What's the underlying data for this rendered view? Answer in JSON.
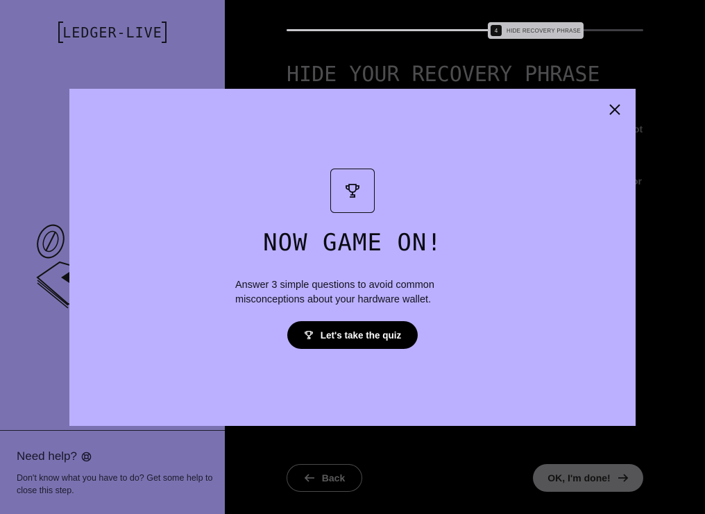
{
  "logo": {
    "text": "LEDGER-LIVE"
  },
  "help": {
    "title": "Need help?",
    "text": "Don't know what you have to do? Get some help to close this step."
  },
  "progress": {
    "step_number": "4",
    "step_label": "HIDE RECOVERY PHRASE",
    "fraction": 0.57
  },
  "page": {
    "title": "HIDE YOUR RECOVERY PHRASE",
    "peek_1": "ot",
    "peek_2": "or",
    "back_label": "Back",
    "done_label": "OK, I'm done!"
  },
  "modal": {
    "title": "NOW GAME ON!",
    "text": "Answer 3 simple questions to avoid common misconceptions about your hardware wallet.",
    "quiz_label": "Let's take the quiz",
    "icon": "trophy-icon",
    "close_icon": "close-icon"
  },
  "colors": {
    "left_panel": "#7a72b0",
    "modal_bg": "#bbb0ff",
    "button_dark": "#000000"
  }
}
